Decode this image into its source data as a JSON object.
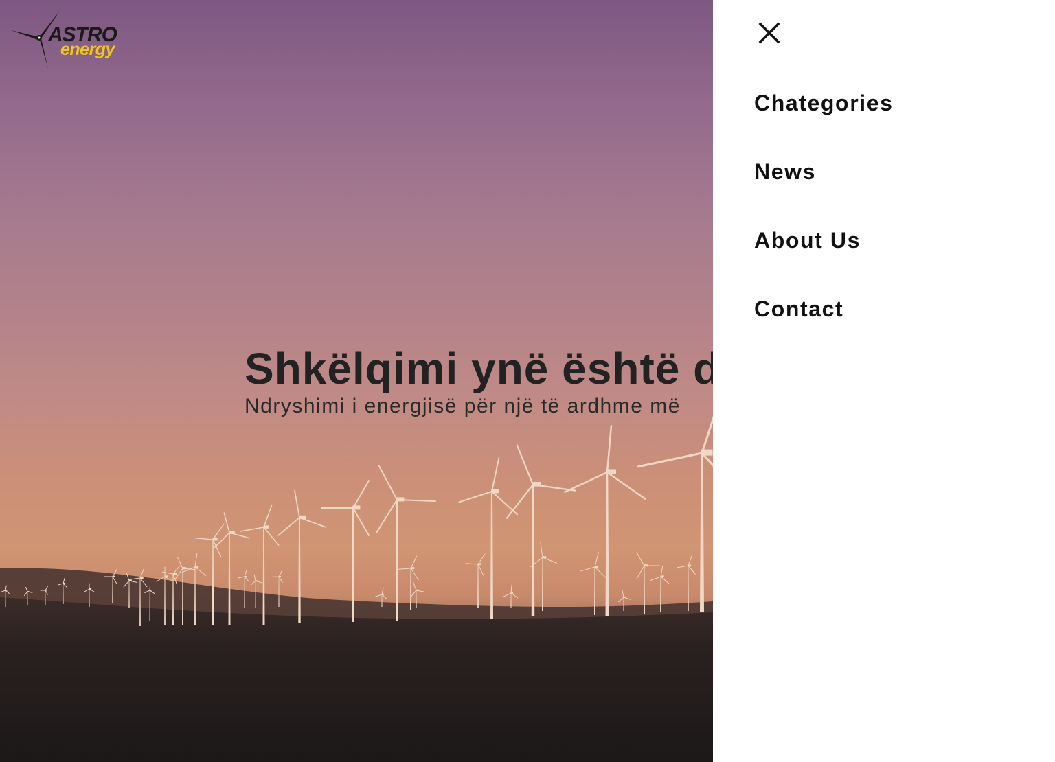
{
  "brand": {
    "name_top": "ASTRO",
    "name_bottom": "energy",
    "icon": "wind-turbine-icon",
    "accent_color": "#f2c719"
  },
  "hero": {
    "title": "Shkëlqimi ynë është di",
    "subtitle": "Ndryshimi i energjisë për një të ardhme më"
  },
  "menu": {
    "close_icon": "close-icon",
    "items": [
      {
        "label": "Chategories"
      },
      {
        "label": "News"
      },
      {
        "label": "About Us"
      },
      {
        "label": "Contact"
      }
    ]
  }
}
